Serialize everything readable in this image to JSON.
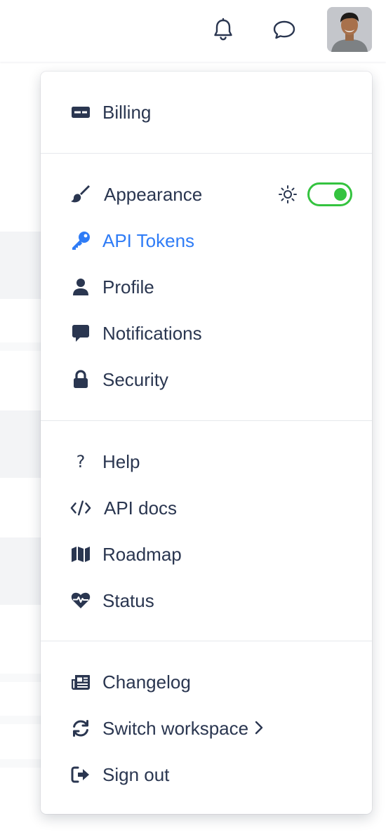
{
  "header": {
    "icons": [
      "bell-icon",
      "chat-bubble-icon"
    ],
    "avatar_alt": "User avatar"
  },
  "menu": {
    "billing": {
      "label": "Billing",
      "icon": "credit-card-icon"
    },
    "appearance": {
      "label": "Appearance",
      "icon": "paintbrush-icon",
      "theme_icon": "sun-icon",
      "toggle_on": true,
      "toggle_color": "#34c33f"
    },
    "api_tokens": {
      "label": "API Tokens",
      "icon": "key-icon",
      "active": true,
      "active_color": "#2f7cf6"
    },
    "profile": {
      "label": "Profile",
      "icon": "user-icon"
    },
    "notifications": {
      "label": "Notifications",
      "icon": "message-icon"
    },
    "security": {
      "label": "Security",
      "icon": "lock-icon"
    },
    "help": {
      "label": "Help",
      "icon": "question-icon",
      "glyph": "?"
    },
    "api_docs": {
      "label": "API docs",
      "icon": "code-icon"
    },
    "roadmap": {
      "label": "Roadmap",
      "icon": "map-icon"
    },
    "status": {
      "label": "Status",
      "icon": "heartbeat-icon"
    },
    "changelog": {
      "label": "Changelog",
      "icon": "newspaper-icon"
    },
    "switch_workspace": {
      "label": "Switch workspace",
      "icon": "sync-icon",
      "chevron": "chevron-right-icon"
    },
    "sign_out": {
      "label": "Sign out",
      "icon": "sign-out-icon"
    }
  },
  "colors": {
    "text": "#2a3650",
    "accent": "#2f7cf6",
    "toggle": "#34c33f"
  }
}
